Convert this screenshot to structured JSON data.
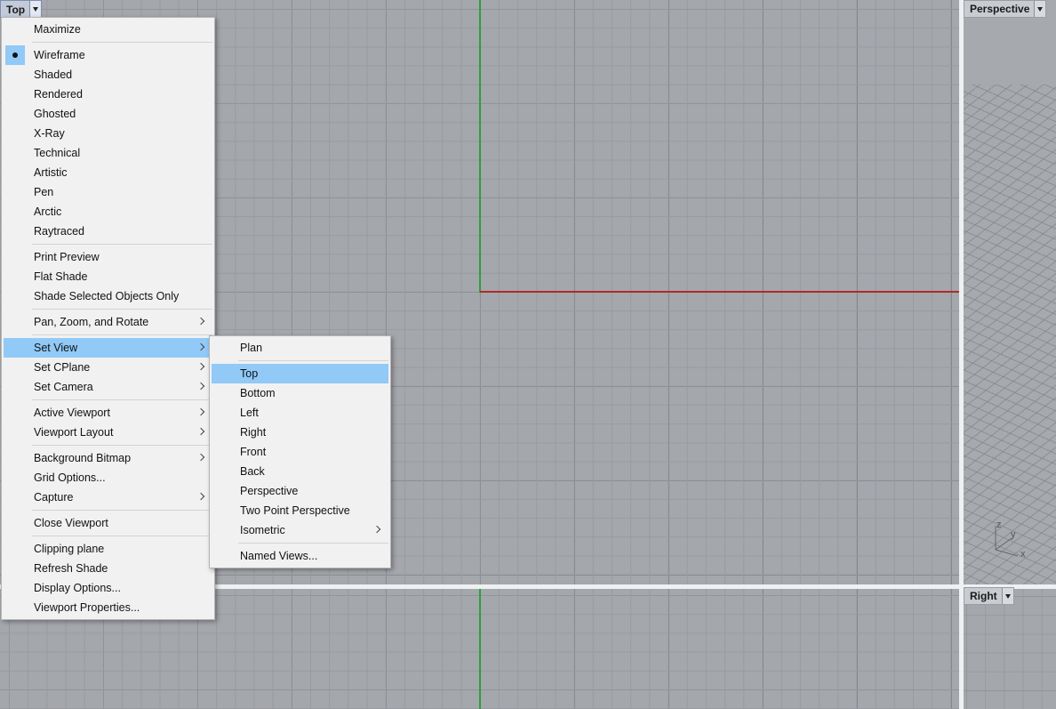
{
  "viewports": {
    "top": {
      "label": "Top"
    },
    "perspective": {
      "label": "Perspective"
    },
    "right": {
      "label": "Right"
    }
  },
  "axis_labels": {
    "z": "z",
    "y": "y",
    "x": "x"
  },
  "main_menu": {
    "maximize": "Maximize",
    "wireframe": "Wireframe",
    "shaded": "Shaded",
    "rendered": "Rendered",
    "ghosted": "Ghosted",
    "xray": "X-Ray",
    "technical": "Technical",
    "artistic": "Artistic",
    "pen": "Pen",
    "arctic": "Arctic",
    "raytraced": "Raytraced",
    "print_preview": "Print Preview",
    "flat_shade": "Flat Shade",
    "shade_selected": "Shade Selected Objects Only",
    "pan_zoom_rotate": "Pan, Zoom, and Rotate",
    "set_view": "Set View",
    "set_cplane": "Set CPlane",
    "set_camera": "Set Camera",
    "active_viewport": "Active Viewport",
    "viewport_layout": "Viewport Layout",
    "background_bitmap": "Background Bitmap",
    "grid_options": "Grid Options...",
    "capture": "Capture",
    "close_viewport": "Close Viewport",
    "clipping_plane": "Clipping plane",
    "refresh_shade": "Refresh Shade",
    "display_options": "Display Options...",
    "viewport_properties": "Viewport Properties..."
  },
  "set_view_menu": {
    "plan": "Plan",
    "top": "Top",
    "bottom": "Bottom",
    "left": "Left",
    "right": "Right",
    "front": "Front",
    "back": "Back",
    "perspective": "Perspective",
    "two_point": "Two Point Perspective",
    "isometric": "Isometric",
    "named_views": "Named Views..."
  }
}
